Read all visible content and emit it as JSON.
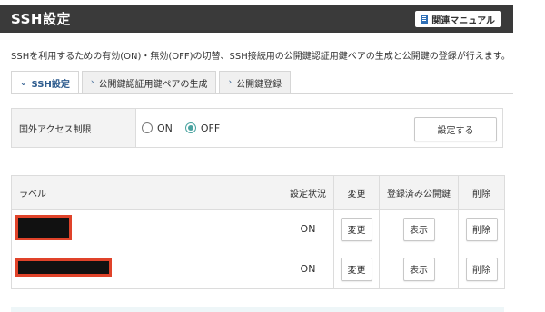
{
  "header": {
    "title": "SSH設定",
    "manual_label": "関連マニュアル",
    "manual_icon": "book-icon"
  },
  "description": "SSHを利用するための有効(ON)・無効(OFF)の切替、SSH接続用の公開鍵認証用鍵ペアの生成と公開鍵の登録が行えます。",
  "tabs": [
    {
      "label": "SSH設定",
      "active": true,
      "icon": "chevron-down-icon"
    },
    {
      "label": "公開鍵認証用鍵ペアの生成",
      "active": false,
      "icon": "chevron-right-icon"
    },
    {
      "label": "公開鍵登録",
      "active": false,
      "icon": "chevron-right-icon"
    }
  ],
  "access_restriction": {
    "label": "国外アクセス制限",
    "options": [
      {
        "label": "ON",
        "checked": false
      },
      {
        "label": "OFF",
        "checked": true
      }
    ],
    "submit_label": "設定する"
  },
  "keys_table": {
    "headers": [
      "ラベル",
      "設定状況",
      "変更",
      "登録済み公開鍵",
      "削除"
    ],
    "rows": [
      {
        "status": "ON",
        "change": "変更",
        "show": "表示",
        "delete": "削除"
      },
      {
        "status": "ON",
        "change": "変更",
        "show": "表示",
        "delete": "削除"
      }
    ]
  },
  "colors": {
    "header_bg": "#3a3a3a",
    "accent": "#2f5d8f",
    "radio_checked": "#4aa3a0",
    "redaction_border": "#e0432a"
  }
}
